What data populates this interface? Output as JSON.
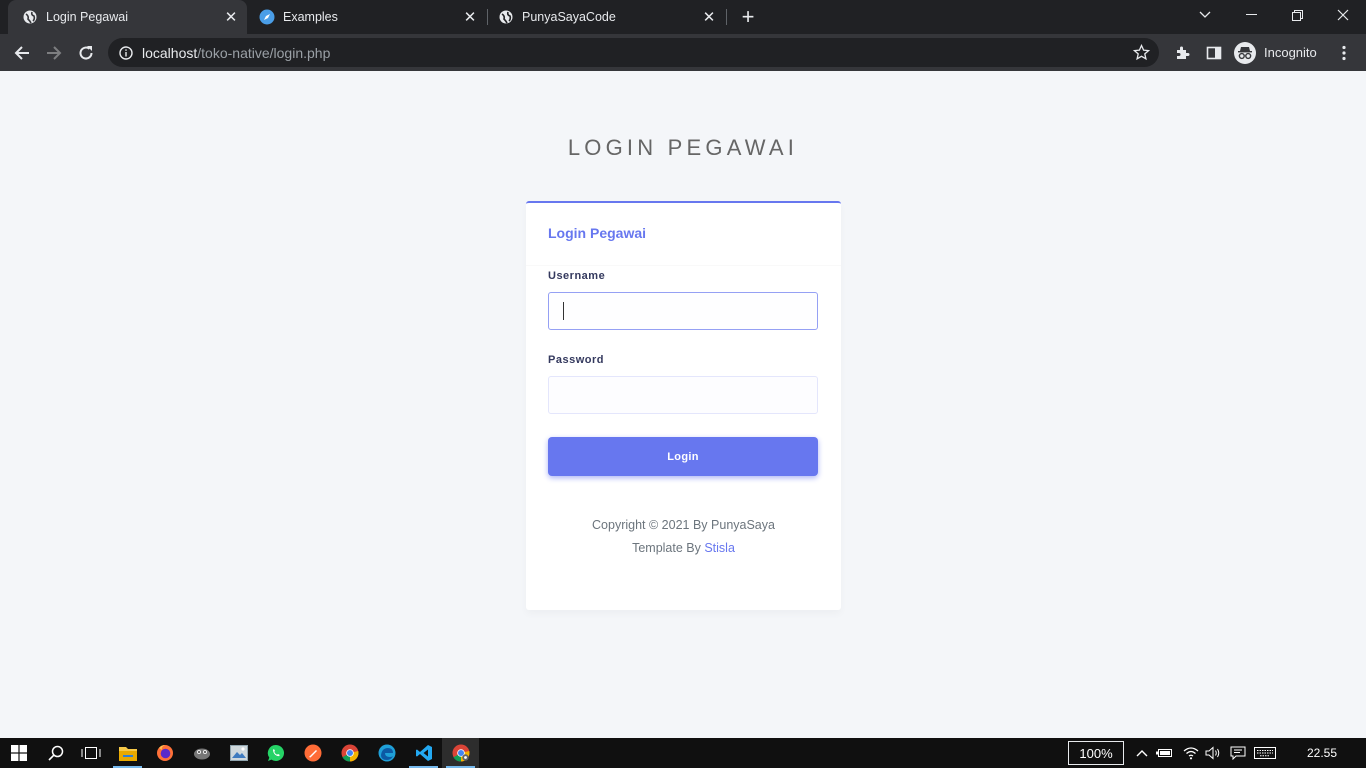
{
  "browser": {
    "tabs": [
      {
        "title": "Login Pegawai",
        "icon": "globe-icon",
        "active": true
      },
      {
        "title": "Examples",
        "icon": "compass-icon",
        "active": false
      },
      {
        "title": "PunyaSayaCode",
        "icon": "globe-icon",
        "active": false
      }
    ],
    "url_host": "localhost",
    "url_path": "/toko-native/login.php",
    "profile_label": "Incognito"
  },
  "page": {
    "heading": "LOGIN PEGAWAI",
    "card_title": "Login Pegawai",
    "username_label": "Username",
    "username_value": "",
    "password_label": "Password",
    "password_value": "",
    "login_label": "Login",
    "copyright": "Copyright © 2021 By PunyaSaya",
    "template_prefix": "Template By ",
    "template_link": "Stisla"
  },
  "colors": {
    "primary": "#6777ef",
    "page_bg": "#f4f6f9",
    "chrome_dark": "#202124",
    "chrome_toolbar": "#35363a"
  },
  "taskbar": {
    "apps": [
      "start-icon",
      "search-icon",
      "task-view-icon",
      "file-explorer-icon",
      "firefox-icon",
      "app-icon",
      "photos-icon",
      "whatsapp-icon",
      "postman-icon",
      "chrome-icon",
      "edge-icon",
      "vscode-icon",
      "chrome-icon"
    ],
    "zoom": "100%",
    "clock": "22.55"
  }
}
